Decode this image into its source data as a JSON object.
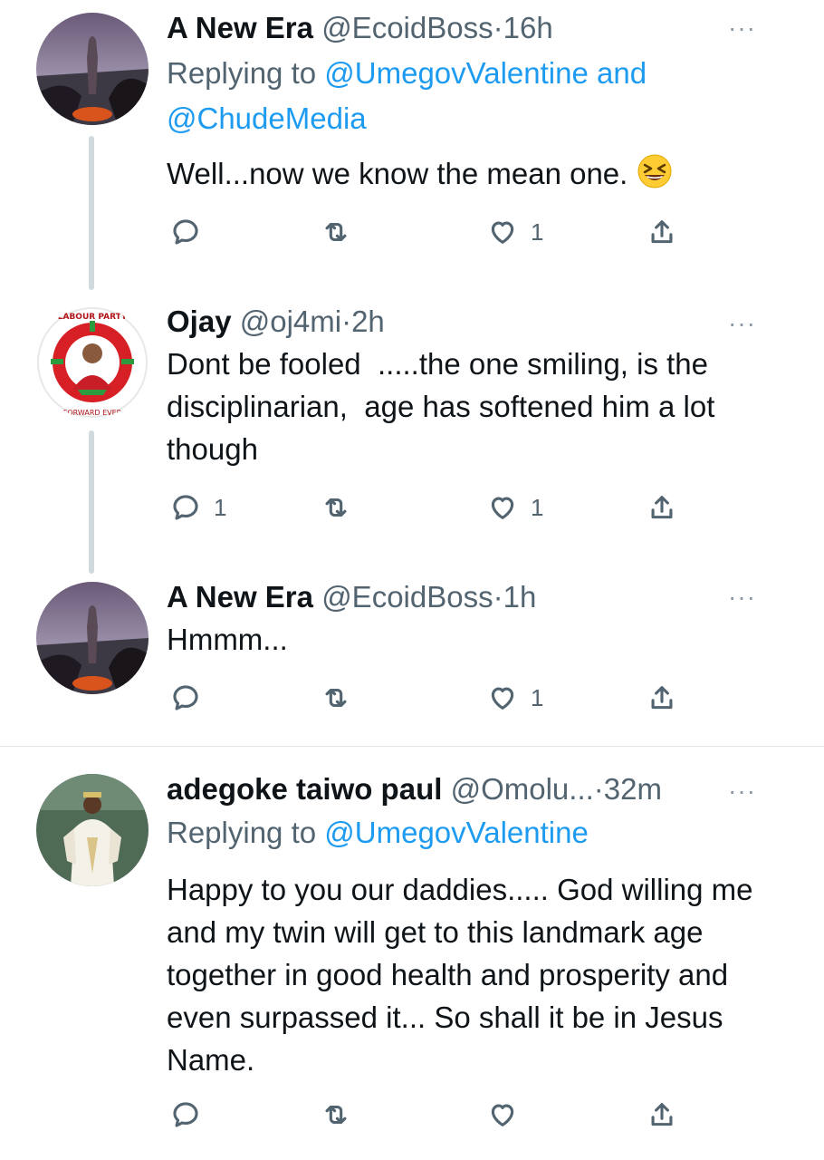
{
  "tweets": [
    {
      "name": "A New Era",
      "handle": "@EcoidBoss",
      "separator": "·",
      "time": "16h",
      "replying_prefix": "Replying to",
      "replying_mentions": "@UmegovValentine and",
      "replying_mentions_2": "@ChudeMedia",
      "text": "Well...now we know the mean one.",
      "emoji_icon": "laughing-face-icon",
      "reply_count": "",
      "retweet_count": "",
      "like_count": "1"
    },
    {
      "name": "Ojay",
      "handle": "@oj4mi",
      "separator": "·",
      "time": "2h",
      "text": "Dont be fooled  .....the one smiling, is the disciplinarian,  age has softened him a lot though",
      "avatar_text_top": "LABOUR PARTY",
      "avatar_text_bottom": "FORWARD EVER",
      "reply_count": "1",
      "retweet_count": "",
      "like_count": "1"
    },
    {
      "name": "A New Era",
      "handle": "@EcoidBoss",
      "separator": "·",
      "time": "1h",
      "text": "Hmmm...",
      "reply_count": "",
      "retweet_count": "",
      "like_count": "1"
    },
    {
      "name": "adegoke taiwo paul",
      "handle": "@Omolu...",
      "separator": "·",
      "time": "32m",
      "replying_prefix": "Replying to",
      "replying_mentions": "@UmegovValentine",
      "text": "Happy to you our daddies..... God willing me and my twin will get to this landmark age together in good health and prosperity and even surpassed it... So shall it be in Jesus Name.",
      "reply_count": "",
      "retweet_count": "",
      "like_count": ""
    }
  ],
  "more_label": "···",
  "colors": {
    "link": "#1d9bf0",
    "muted": "#536471",
    "thread": "#cfd9de"
  }
}
